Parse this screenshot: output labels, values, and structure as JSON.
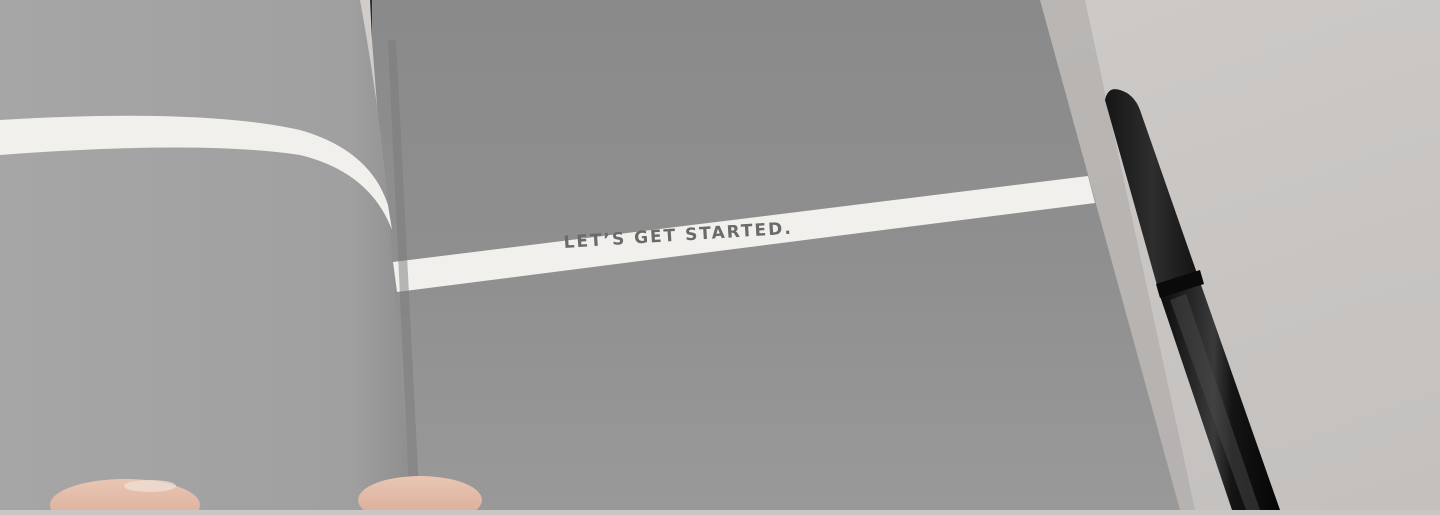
{
  "photo": {
    "subject": "open-booklet-with-pen",
    "colors": {
      "table": "#c9c6c4",
      "page": "#8e8e8e",
      "band": "#f1f0ec",
      "pen": "#1a1a1a"
    }
  },
  "book": {
    "banner_text": "LET’S GET STARTED."
  }
}
